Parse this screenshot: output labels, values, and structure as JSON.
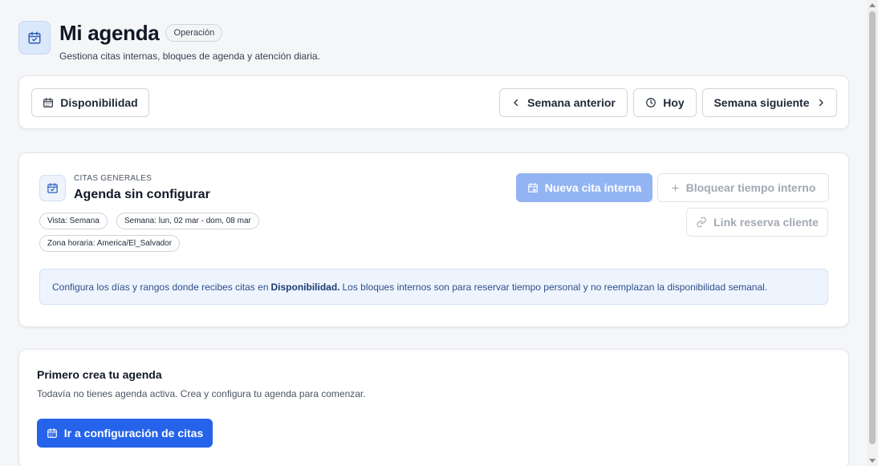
{
  "header": {
    "title": "Mi agenda",
    "badge": "Operación",
    "subtitle": "Gestiona citas internas, bloques de agenda y atención diaria.",
    "icon": "calendar-check-icon"
  },
  "toolbar": {
    "availability_label": "Disponibilidad",
    "prev_week_label": "Semana anterior",
    "today_label": "Hoy",
    "next_week_label": "Semana siguiente"
  },
  "agenda": {
    "eyebrow": "CITAS GENERALES",
    "name": "Agenda sin configurar",
    "chips": {
      "view": "Vista: Semana",
      "week": "Semana: lun, 02 mar - dom, 08 mar",
      "timezone": "Zona horaria: America/El_Salvador"
    },
    "new_appointment_label": "Nueva cita interna",
    "block_time_label": "Bloquear tiempo interno",
    "booking_link_label": "Link reserva cliente",
    "info": {
      "before": "Configura los días y rangos donde recibes citas en",
      "link": "Disponibilidad.",
      "after": "Los bloques internos son para reservar tiempo personal y no reemplazan la disponibilidad semanal."
    }
  },
  "empty_state": {
    "title": "Primero crea tu agenda",
    "text": "Todavía no tienes agenda activa. Crea y configura tu agenda para comenzar.",
    "button_label": "Ir a configuración de citas"
  },
  "colors": {
    "primary": "#2563eb",
    "primary_disabled": "#93b4f3",
    "info_bg": "#eef4fd",
    "icon_accent": "#2f5fb8"
  }
}
